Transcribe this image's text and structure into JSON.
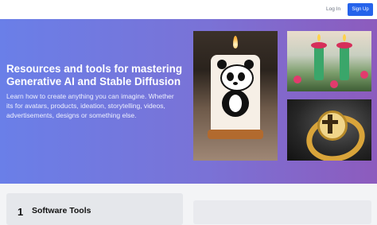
{
  "header": {
    "login_label": "Log In",
    "signup_label": "Sign Up"
  },
  "hero": {
    "headline": "Resources and tools for mastering Generative AI and Stable Diffusion",
    "subtext": "Learn how to create anything you can imagine. Whether its for avatars, products, ideation, storytelling, videos, advertisements, designs or something else."
  },
  "sections": [
    {
      "number": "1",
      "title": "Software Tools"
    }
  ],
  "colors": {
    "accent": "#2563eb",
    "hero_start": "#6a7fe8",
    "hero_end": "#8d5bbd"
  }
}
